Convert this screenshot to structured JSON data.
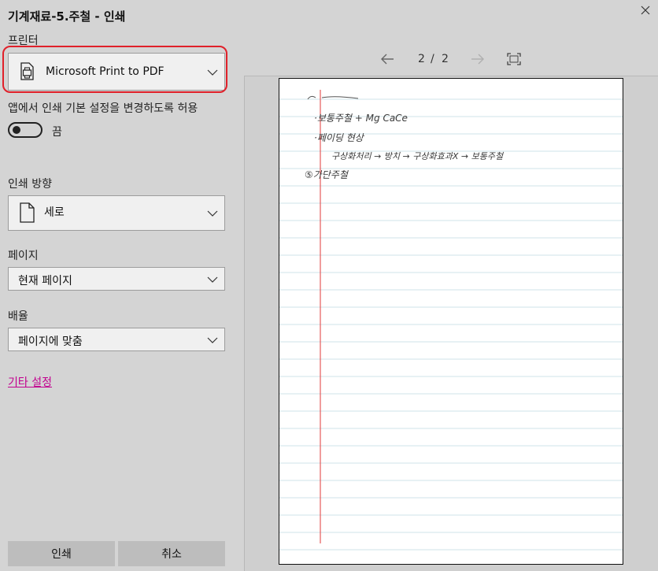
{
  "window": {
    "title": "기계재료-5.주철 - 인쇄"
  },
  "printer": {
    "label": "프린터",
    "value": "Microsoft Print to PDF"
  },
  "app_settings": {
    "label": "앱에서 인쇄 기본 설정을 변경하도록 허용",
    "toggle_state": "끔"
  },
  "orientation": {
    "label": "인쇄 방향",
    "value": "세로"
  },
  "pages": {
    "label": "페이지",
    "value": "현재 페이지"
  },
  "scale": {
    "label": "배율",
    "value": "페이지에 맞춤"
  },
  "more_settings": "기타 설정",
  "buttons": {
    "print": "인쇄",
    "cancel": "취소"
  },
  "preview": {
    "current_page": "2",
    "separator": "/",
    "total_pages": "2",
    "notes": [
      "·보통주철 + Mg CaCe",
      "·페이딩 현상",
      "구상화처리 → 방치 → 구상화효과X → 보통주철",
      "⑤가단주철"
    ]
  },
  "colors": {
    "highlight": "#e0202a",
    "link": "#c2008f"
  }
}
